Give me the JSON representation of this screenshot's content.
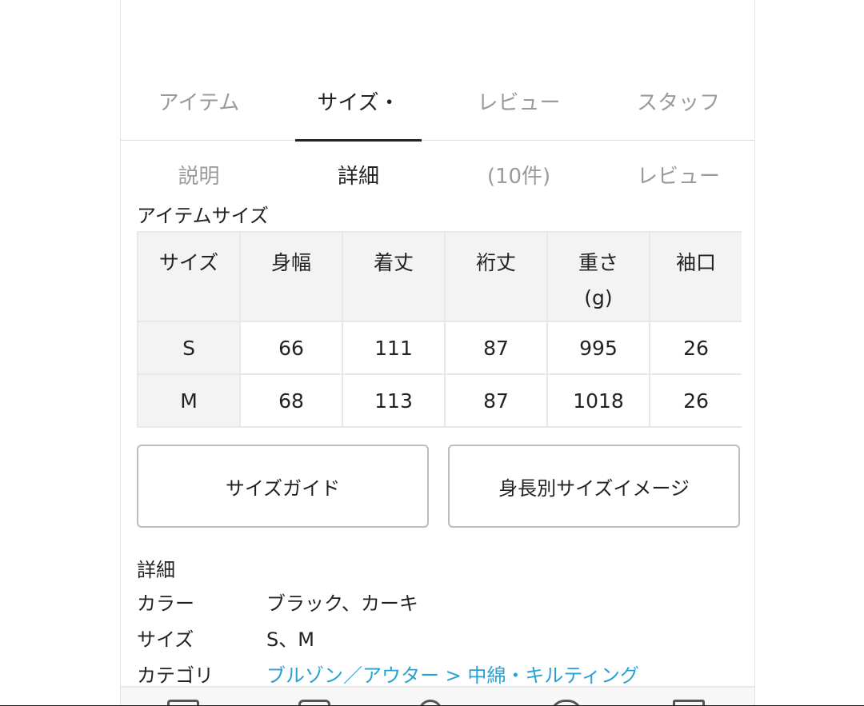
{
  "tabs": [
    {
      "line1": "アイテム",
      "line2": "説明",
      "active": false
    },
    {
      "line1": "サイズ・",
      "line2": "詳細",
      "active": true
    },
    {
      "line1": "レビュー",
      "line2": "(10件)",
      "active": false
    },
    {
      "line1": "スタッフ",
      "line2": "レビュー",
      "active": false
    }
  ],
  "item_size": {
    "title": "アイテムサイズ",
    "headers": [
      {
        "l1": "サイズ",
        "l2": ""
      },
      {
        "l1": "身幅",
        "l2": ""
      },
      {
        "l1": "着丈",
        "l2": ""
      },
      {
        "l1": "裄丈",
        "l2": ""
      },
      {
        "l1": "重さ",
        "l2": "(g)"
      },
      {
        "l1": "袖口",
        "l2": ""
      }
    ],
    "rows": [
      [
        "S",
        "66",
        "111",
        "87",
        "995",
        "26"
      ],
      [
        "M",
        "68",
        "113",
        "87",
        "1018",
        "26"
      ]
    ]
  },
  "buttons": {
    "size_guide": "サイズガイド",
    "height_image": "身長別サイズイメージ"
  },
  "details": {
    "title": "詳細",
    "color_label": "カラー",
    "color_value": "ブラック、カーキ",
    "size_label": "サイズ",
    "size_value": "S、M",
    "category_label": "カテゴリ",
    "category_value": "ブルゾン／アウター > 中綿・キルティング"
  },
  "colors": {
    "link": "#2aa1d3",
    "active_text": "#222222",
    "inactive_text": "#9a9a9a"
  }
}
